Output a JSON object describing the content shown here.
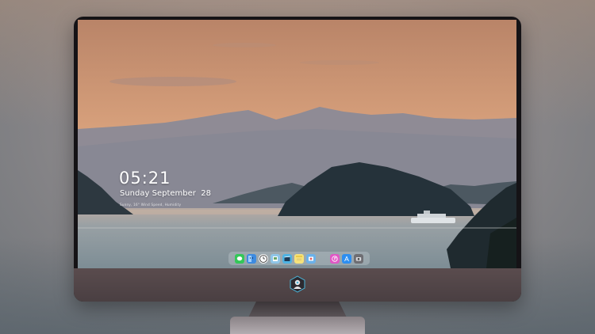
{
  "lock_screen": {
    "time": "05:21",
    "date": "Sunday September  28",
    "subtitle": "Sunny, 16°  Wind Speed, Humidity"
  },
  "dock": {
    "apps": [
      {
        "name": "messages-icon",
        "color": "#34c759"
      },
      {
        "name": "finder-icon",
        "color": "#3d8be0"
      },
      {
        "name": "clock-icon",
        "color": "#f2f2f2"
      },
      {
        "name": "preview-icon",
        "color": "#8fc6e8"
      },
      {
        "name": "video-editor-icon",
        "color": "#4fb3e3"
      },
      {
        "name": "notes-icon",
        "color": "#f6e27a"
      },
      {
        "name": "photos-icon",
        "color": "#6bb1e9"
      },
      {
        "name": "itunes-icon",
        "color": "#e058c5"
      },
      {
        "name": "app-store-icon",
        "color": "#2d8ef0"
      },
      {
        "name": "camera-icon",
        "color": "#6e6e73"
      }
    ]
  },
  "colors": {
    "sky_top": "#c9977a",
    "sky_horizon": "#e8b891",
    "water": "#8d9aa1",
    "accent_logo": "#4ab4d8"
  }
}
